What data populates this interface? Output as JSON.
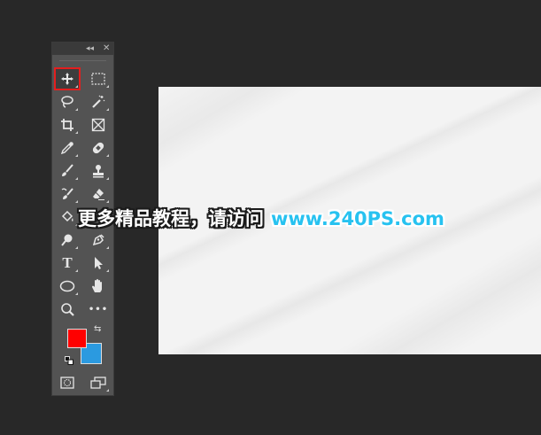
{
  "toolbar": {
    "collapse_glyph": "◂◂",
    "close_glyph": "✕",
    "tools": [
      {
        "name": "move-tool",
        "icon": "move-icon",
        "selected": true
      },
      {
        "name": "marquee-tool",
        "icon": "rectangle-marquee-icon"
      },
      {
        "name": "lasso-tool",
        "icon": "lasso-icon"
      },
      {
        "name": "magic-wand-tool",
        "icon": "magic-wand-icon"
      },
      {
        "name": "crop-tool",
        "icon": "crop-icon"
      },
      {
        "name": "frame-tool",
        "icon": "frame-icon"
      },
      {
        "name": "eyedropper-tool",
        "icon": "eyedropper-icon"
      },
      {
        "name": "healing-brush-tool",
        "icon": "bandage-icon"
      },
      {
        "name": "brush-tool",
        "icon": "brush-icon"
      },
      {
        "name": "stamp-tool",
        "icon": "clone-stamp-icon"
      },
      {
        "name": "history-brush-tool",
        "icon": "history-brush-icon"
      },
      {
        "name": "eraser-tool",
        "icon": "eraser-icon"
      },
      {
        "name": "paint-bucket-tool",
        "icon": "paint-bucket-icon"
      },
      {
        "name": "blur-tool",
        "icon": "blur-drop-icon"
      },
      {
        "name": "dodge-tool",
        "icon": "dodge-icon"
      },
      {
        "name": "pen-tool",
        "icon": "pen-icon"
      },
      {
        "name": "type-tool",
        "icon": "type-icon",
        "label": "T"
      },
      {
        "name": "path-selection-tool",
        "icon": "arrow-pointer-icon"
      },
      {
        "name": "ellipse-tool",
        "icon": "ellipse-icon"
      },
      {
        "name": "hand-tool",
        "icon": "hand-icon"
      },
      {
        "name": "zoom-tool",
        "icon": "zoom-icon"
      },
      {
        "name": "more-tools",
        "icon": "ellipsis-icon",
        "label": "•••"
      }
    ],
    "foreground_color": "#ff0000",
    "background_color": "#2b9ae0",
    "swap_glyph": "⇆"
  },
  "watermark": {
    "chinese_text": "更多精品教程，请访问",
    "url_text": "www.240PS.com"
  },
  "colors": {
    "app_background": "#282828",
    "panel": "#535353",
    "selection_outline": "#e41e1e"
  }
}
